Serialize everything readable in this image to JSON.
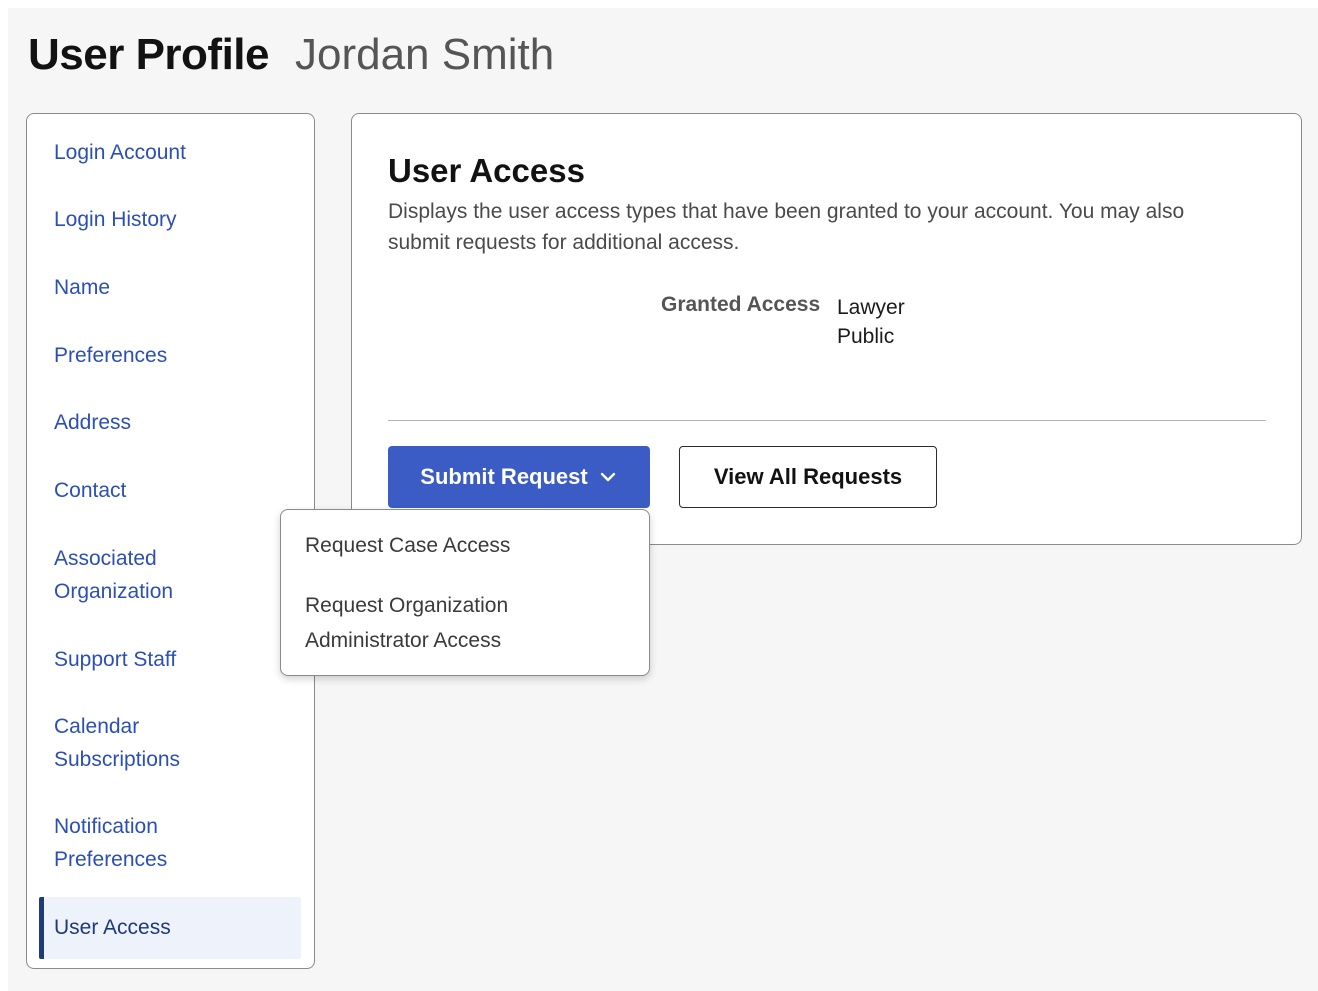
{
  "header": {
    "title": "User Profile",
    "user_name": "Jordan Smith"
  },
  "sidebar": {
    "items": [
      {
        "label": "Login Account"
      },
      {
        "label": "Login History"
      },
      {
        "label": "Name"
      },
      {
        "label": "Preferences"
      },
      {
        "label": "Address"
      },
      {
        "label": "Contact"
      },
      {
        "label": "Associated\nOrganization"
      },
      {
        "label": "Support Staff"
      },
      {
        "label": "Calendar\nSubscriptions"
      },
      {
        "label": "Notification\nPreferences"
      },
      {
        "label": "User Access",
        "active": true
      }
    ]
  },
  "main": {
    "title": "User Access",
    "description": "Displays the user access types that have been granted to your account. You may also submit requests for additional access.",
    "granted_label": "Granted Access",
    "granted_values": [
      "Lawyer",
      "Public"
    ],
    "submit_label": "Submit Request",
    "submit_icon": "chevron-down-icon",
    "view_all_label": "View All Requests"
  },
  "dropdown": {
    "items": [
      {
        "label": "Request Case Access"
      },
      {
        "label": "Request Organization\nAdministrator Access"
      }
    ]
  },
  "colors": {
    "accent": "#3b5cc4",
    "link": "#2c4fb5",
    "active_bg": "#eef2fb",
    "active_border": "#1f3b7a",
    "page_bg": "#f6f6f6"
  }
}
